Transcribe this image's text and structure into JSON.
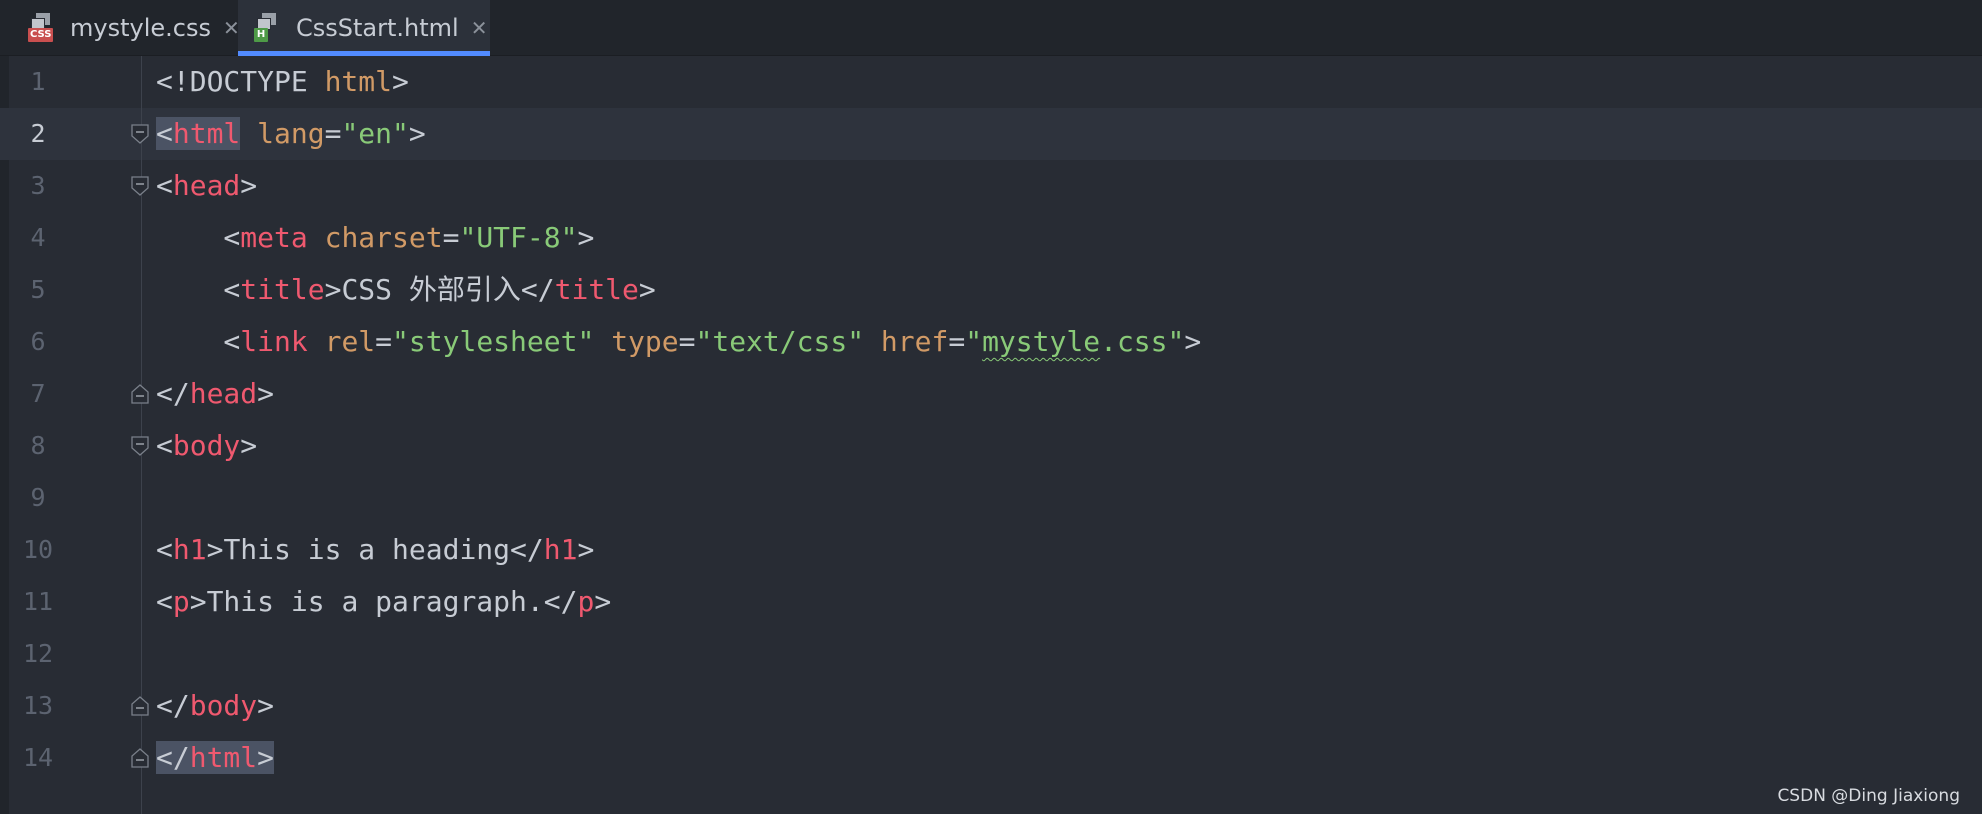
{
  "tabs": [
    {
      "label": "mystyle.css",
      "icon": "css-file-icon",
      "badge": "CSS",
      "close": "✕",
      "active": false
    },
    {
      "label": "CssStart.html",
      "icon": "html-file-icon",
      "badge": "H",
      "close": "✕",
      "active": true
    }
  ],
  "editor": {
    "current_line": 2,
    "lines": [
      {
        "num": "1",
        "tokens": [
          {
            "t": "p",
            "v": "<!DOCTYPE "
          },
          {
            "t": "at",
            "v": "html"
          },
          {
            "t": "p",
            "v": ">"
          }
        ]
      },
      {
        "num": "2",
        "fold": true,
        "tokens": [
          {
            "t": "p",
            "v": "<",
            "hl": true
          },
          {
            "t": "tg",
            "v": "html",
            "hl": true
          },
          {
            "t": "p",
            "v": " "
          },
          {
            "t": "at",
            "v": "lang"
          },
          {
            "t": "p",
            "v": "="
          },
          {
            "t": "st",
            "v": "\"en\""
          },
          {
            "t": "p",
            "v": ">"
          }
        ]
      },
      {
        "num": "3",
        "fold": true,
        "tokens": [
          {
            "t": "p",
            "v": "<"
          },
          {
            "t": "tg",
            "v": "head"
          },
          {
            "t": "p",
            "v": ">"
          }
        ]
      },
      {
        "num": "4",
        "tokens": [
          {
            "t": "p",
            "v": "    <"
          },
          {
            "t": "tg",
            "v": "meta"
          },
          {
            "t": "p",
            "v": " "
          },
          {
            "t": "at",
            "v": "charset"
          },
          {
            "t": "p",
            "v": "="
          },
          {
            "t": "st",
            "v": "\"UTF-8\""
          },
          {
            "t": "p",
            "v": ">"
          }
        ]
      },
      {
        "num": "5",
        "tokens": [
          {
            "t": "p",
            "v": "    <"
          },
          {
            "t": "tg",
            "v": "title"
          },
          {
            "t": "p",
            "v": ">"
          },
          {
            "t": "tx",
            "v": "CSS 外部引入"
          },
          {
            "t": "p",
            "v": "</"
          },
          {
            "t": "tg",
            "v": "title"
          },
          {
            "t": "p",
            "v": ">"
          }
        ]
      },
      {
        "num": "6",
        "tokens": [
          {
            "t": "p",
            "v": "    <"
          },
          {
            "t": "tg",
            "v": "link"
          },
          {
            "t": "p",
            "v": " "
          },
          {
            "t": "at",
            "v": "rel"
          },
          {
            "t": "p",
            "v": "="
          },
          {
            "t": "st",
            "v": "\"stylesheet\""
          },
          {
            "t": "p",
            "v": " "
          },
          {
            "t": "at",
            "v": "type"
          },
          {
            "t": "p",
            "v": "="
          },
          {
            "t": "st",
            "v": "\"text/css\""
          },
          {
            "t": "p",
            "v": " "
          },
          {
            "t": "at",
            "v": "href"
          },
          {
            "t": "p",
            "v": "="
          },
          {
            "t": "st",
            "v": "\""
          },
          {
            "t": "st",
            "v": "mystyle",
            "squig": true
          },
          {
            "t": "st",
            "v": ".css\""
          },
          {
            "t": "p",
            "v": ">"
          }
        ]
      },
      {
        "num": "7",
        "fold": true,
        "tokens": [
          {
            "t": "p",
            "v": "</"
          },
          {
            "t": "tg",
            "v": "head"
          },
          {
            "t": "p",
            "v": ">"
          }
        ]
      },
      {
        "num": "8",
        "fold": true,
        "tokens": [
          {
            "t": "p",
            "v": "<"
          },
          {
            "t": "tg",
            "v": "body"
          },
          {
            "t": "p",
            "v": ">"
          }
        ]
      },
      {
        "num": "9",
        "tokens": []
      },
      {
        "num": "10",
        "tokens": [
          {
            "t": "p",
            "v": "<"
          },
          {
            "t": "tg",
            "v": "h1"
          },
          {
            "t": "p",
            "v": ">"
          },
          {
            "t": "tx",
            "v": "This is a heading"
          },
          {
            "t": "p",
            "v": "</"
          },
          {
            "t": "tg",
            "v": "h1"
          },
          {
            "t": "p",
            "v": ">"
          }
        ]
      },
      {
        "num": "11",
        "tokens": [
          {
            "t": "p",
            "v": "<"
          },
          {
            "t": "tg",
            "v": "p"
          },
          {
            "t": "p",
            "v": ">"
          },
          {
            "t": "tx",
            "v": "This is a paragraph."
          },
          {
            "t": "p",
            "v": "</"
          },
          {
            "t": "tg",
            "v": "p"
          },
          {
            "t": "p",
            "v": ">"
          }
        ]
      },
      {
        "num": "12",
        "tokens": []
      },
      {
        "num": "13",
        "fold": true,
        "tokens": [
          {
            "t": "p",
            "v": "</"
          },
          {
            "t": "tg",
            "v": "body"
          },
          {
            "t": "p",
            "v": ">"
          }
        ]
      },
      {
        "num": "14",
        "fold": true,
        "tokens": [
          {
            "t": "p",
            "v": "</",
            "hl": true
          },
          {
            "t": "tg",
            "v": "html",
            "hl": true
          },
          {
            "t": "p",
            "v": ">",
            "hl": true
          }
        ]
      }
    ]
  },
  "watermark": "CSDN @Ding Jiaxiong",
  "colors": {
    "background": "#282c34",
    "tab_active_underline": "#528bff",
    "tag": "#ef596f",
    "attribute": "#d19a66",
    "string": "#89ca78"
  }
}
